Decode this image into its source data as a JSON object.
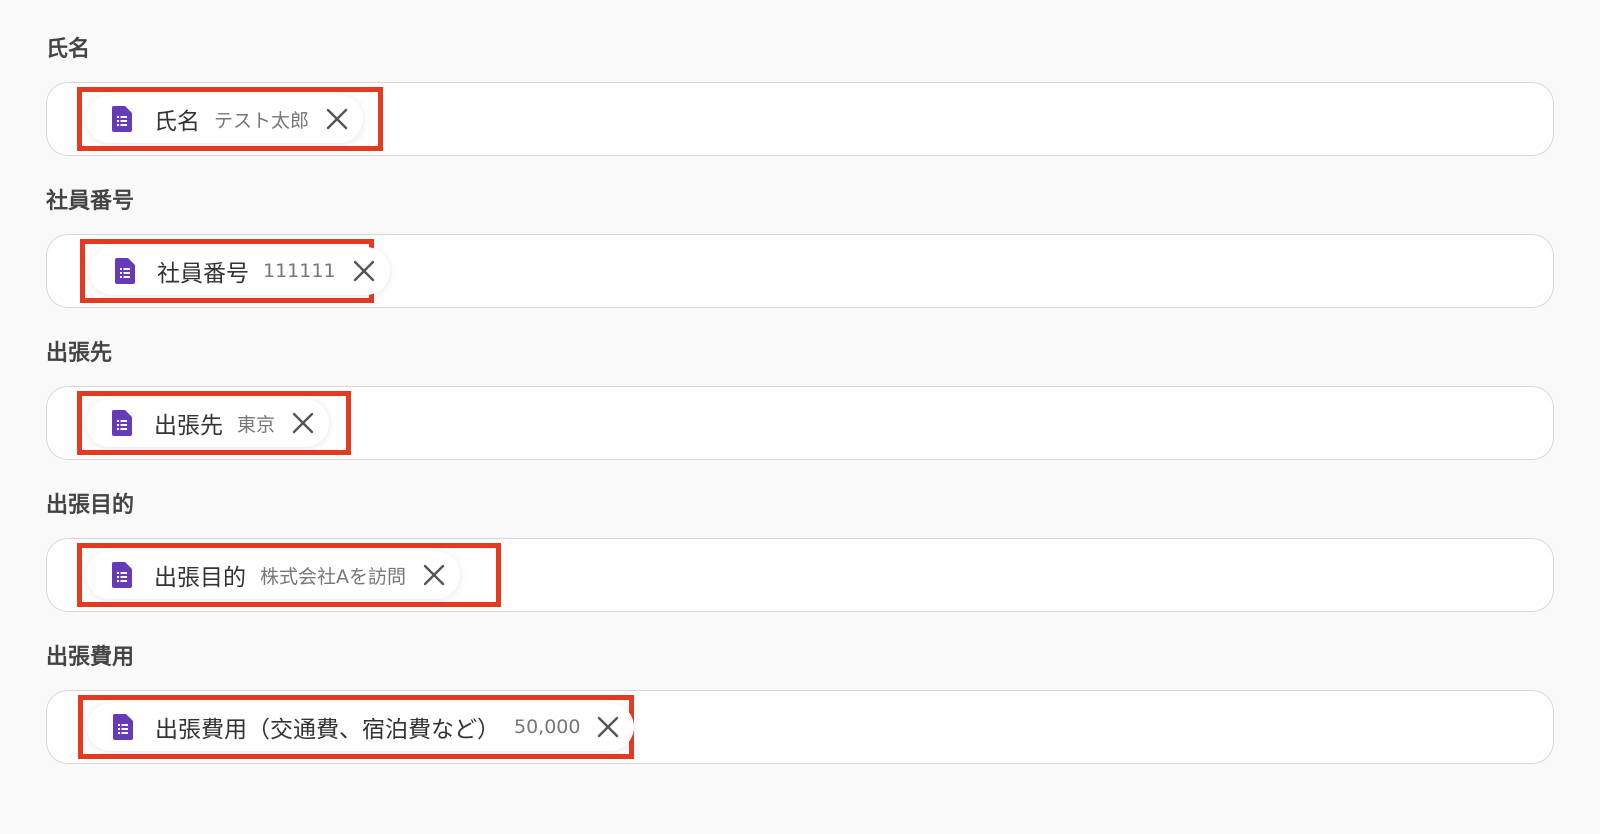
{
  "fields": [
    {
      "label": "氏名",
      "token_name": "氏名",
      "token_value": "テスト太郎",
      "token_icon": "google-forms-icon",
      "remove_icon": "close-icon"
    },
    {
      "label": "社員番号",
      "token_name": "社員番号",
      "token_value": "111111",
      "token_icon": "google-forms-icon",
      "remove_icon": "close-icon"
    },
    {
      "label": "出張先",
      "token_name": "出張先",
      "token_value": "東京",
      "token_icon": "google-forms-icon",
      "remove_icon": "close-icon"
    },
    {
      "label": "出張目的",
      "token_name": "出張目的",
      "token_value": "株式会社Aを訪問",
      "token_icon": "google-forms-icon",
      "remove_icon": "close-icon"
    },
    {
      "label": "出張費用",
      "token_name": "出張費用（交通費、宿泊費など）",
      "token_value": "50,000",
      "token_icon": "google-forms-icon",
      "remove_icon": "close-icon"
    }
  ],
  "colors": {
    "background": "#f9f9f9",
    "highlight_border": "#e53a22",
    "forms_icon": "#673ab7",
    "label_text": "#444444"
  }
}
